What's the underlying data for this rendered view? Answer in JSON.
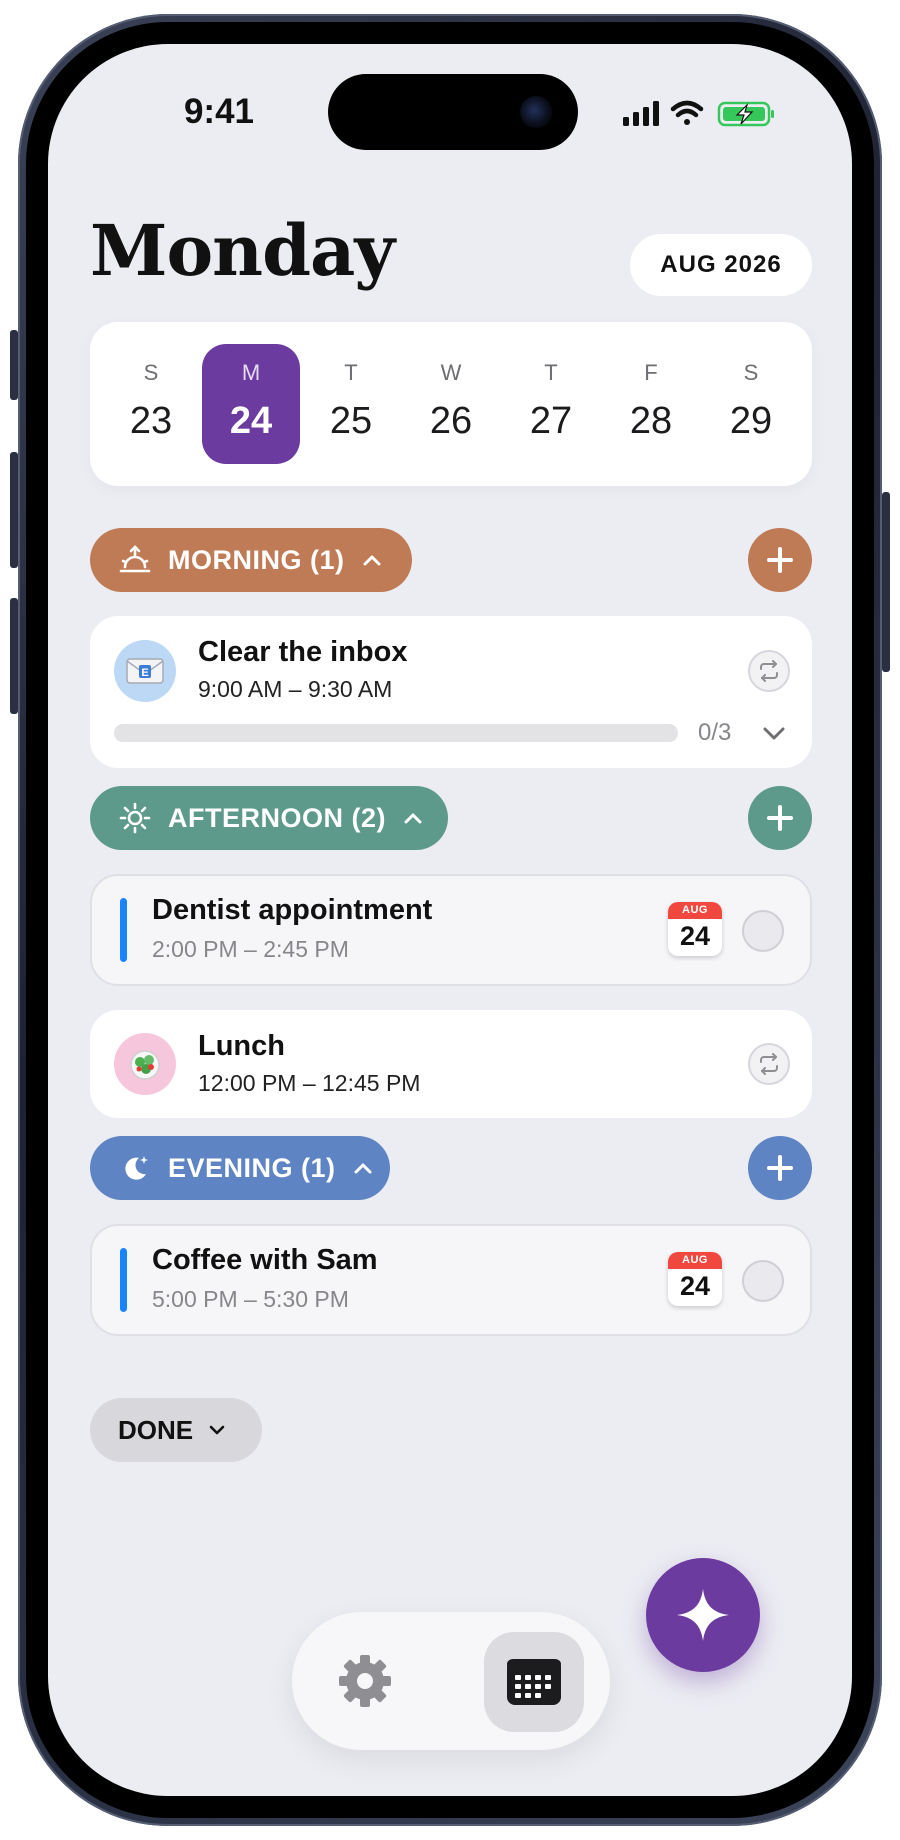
{
  "status_bar": {
    "time": "9:41"
  },
  "header": {
    "day_title": "Monday",
    "month_label": "AUG 2026"
  },
  "week": {
    "days": [
      {
        "dow": "S",
        "num": "23"
      },
      {
        "dow": "M",
        "num": "24",
        "selected": true
      },
      {
        "dow": "T",
        "num": "25"
      },
      {
        "dow": "W",
        "num": "26"
      },
      {
        "dow": "T",
        "num": "27"
      },
      {
        "dow": "F",
        "num": "28"
      },
      {
        "dow": "S",
        "num": "29"
      }
    ]
  },
  "sections": {
    "morning": {
      "label": "MORNING (1)",
      "color": "#bf7b56",
      "icon": "sunrise-icon",
      "tasks": [
        {
          "title": "Clear the inbox",
          "time": "9:00 AM – 9:30 AM",
          "icon": "envelope-icon",
          "progress_label": "0/3",
          "progress": 0
        }
      ]
    },
    "afternoon": {
      "label": "AFTERNOON (2)",
      "color": "#5d9a8c",
      "icon": "sun-icon",
      "tasks": [
        {
          "title": "Dentist appointment",
          "time": "2:00 PM – 2:45 PM",
          "cal_month": "AUG",
          "cal_day": "24"
        },
        {
          "title": "Lunch",
          "time": "12:00 PM – 12:45 PM",
          "icon": "salad-icon"
        }
      ]
    },
    "evening": {
      "label": "EVENING (1)",
      "color": "#5f84c4",
      "icon": "moon-stars-icon",
      "tasks": [
        {
          "title": "Coffee with Sam",
          "time": "5:00 PM – 5:30 PM",
          "cal_month": "AUG",
          "cal_day": "24"
        }
      ]
    }
  },
  "done": {
    "label": "DONE"
  },
  "colors": {
    "accent": "#6c3ba0",
    "event_bar": "#1a84ff",
    "background": "#ecedf3"
  }
}
